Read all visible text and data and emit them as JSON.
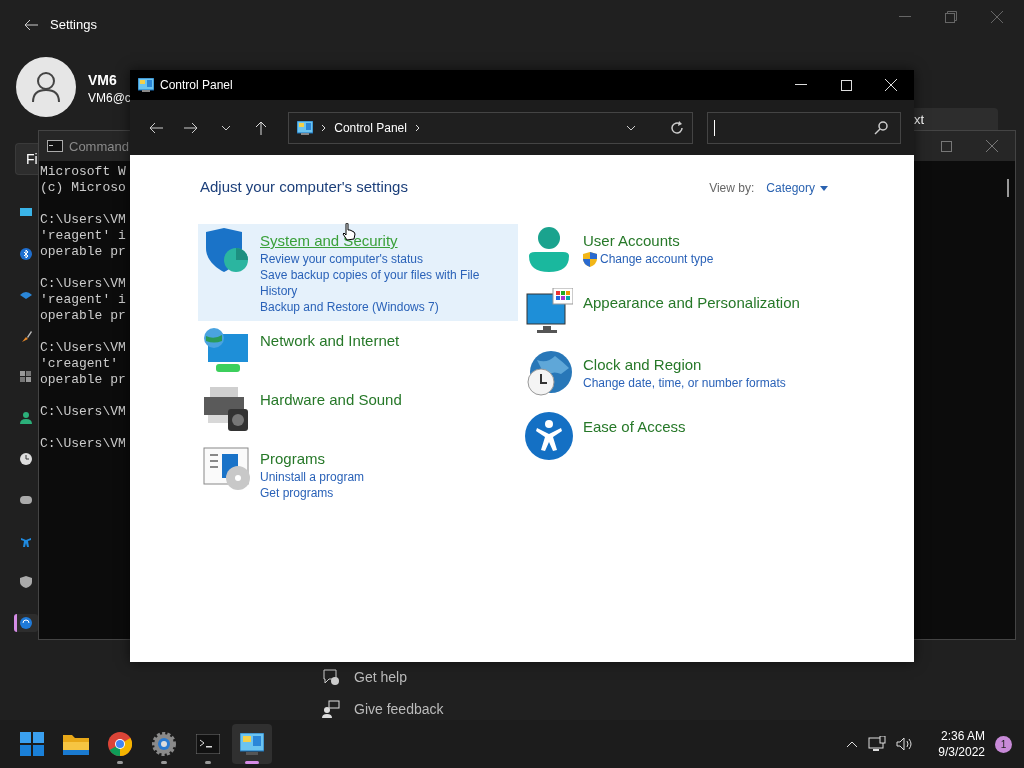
{
  "settings_window": {
    "title": "Settings",
    "user_name": "VM6",
    "user_email": "VM6@c",
    "side_button": "Fi",
    "next_button": "xt",
    "sidebar_items": [
      {
        "selected": false
      },
      {
        "selected": false
      },
      {
        "selected": false
      },
      {
        "selected": false
      },
      {
        "selected": false
      },
      {
        "selected": false
      },
      {
        "selected": false
      },
      {
        "selected": false
      },
      {
        "selected": false
      },
      {
        "selected": false
      },
      {
        "selected": true
      }
    ],
    "help_links": [
      "Get help",
      "Give feedback"
    ]
  },
  "command_window": {
    "title": "Command",
    "output_blocks": [
      [
        "Microsoft W",
        "(c) Microso"
      ],
      [
        "C:\\Users\\VM",
        "'reagent' i",
        "operable pr"
      ],
      [
        "C:\\Users\\VM",
        "'reagent' i",
        "operable pr"
      ],
      [
        "C:\\Users\\VM",
        "'creagent'",
        "operable pr"
      ],
      [
        "C:\\Users\\VM"
      ],
      [
        "C:\\Users\\VM"
      ]
    ]
  },
  "control_panel": {
    "title": "Control Panel",
    "breadcrumb": [
      "Control Panel"
    ],
    "heading": "Adjust your computer's settings",
    "view_by_label": "View by:",
    "view_by_value": "Category",
    "columns": [
      [
        {
          "title": "System and Security",
          "highlighted": true,
          "links": [
            {
              "text": "Review your computer's status",
              "shield": false
            },
            {
              "text": "Save backup copies of your files with File History",
              "shield": false
            },
            {
              "text": "Backup and Restore (Windows 7)",
              "shield": false
            }
          ]
        },
        {
          "title": "Network and Internet",
          "highlighted": false
        },
        {
          "title": "Hardware and Sound",
          "highlighted": false
        },
        {
          "title": "Programs",
          "highlighted": false,
          "links": [
            {
              "text": "Uninstall a program",
              "shield": false
            },
            {
              "text": "Get programs",
              "shield": false
            }
          ]
        }
      ],
      [
        {
          "title": "User Accounts",
          "highlighted": false,
          "links": [
            {
              "text": "Change account type",
              "shield": true
            }
          ]
        },
        {
          "title": "Appearance and Personalization",
          "highlighted": false
        },
        {
          "title": "Clock and Region",
          "highlighted": false,
          "links": [
            {
              "text": "Change date, time, or number formats",
              "shield": false
            }
          ]
        },
        {
          "title": "Ease of Access",
          "highlighted": false
        }
      ]
    ]
  },
  "taskbar": {
    "apps": [
      {
        "running": false,
        "active": false
      },
      {
        "running": false,
        "active": false
      },
      {
        "running": true,
        "active": false
      },
      {
        "running": true,
        "active": false
      },
      {
        "running": true,
        "active": false
      },
      {
        "running": true,
        "active": true
      }
    ],
    "time": "2:36 AM",
    "date": "9/3/2022",
    "notification_count": "1"
  }
}
